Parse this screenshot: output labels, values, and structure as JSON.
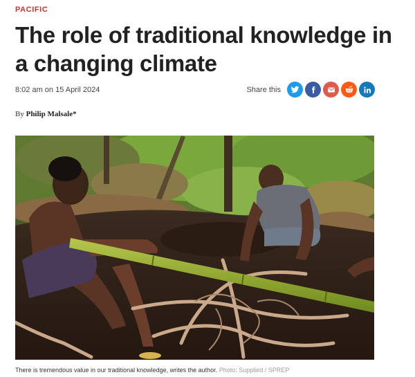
{
  "article": {
    "kicker": "PACIFIC",
    "headline": "The role of traditional knowledge in a changing climate",
    "timestamp": "8:02 am on 15 April 2024",
    "byline_prefix": "By",
    "author": "Philip Malsale*",
    "caption": "There is tremendous value in our traditional knowledge, writes the author.",
    "photo_credit": "Photo: Supplied / SPREP"
  },
  "share": {
    "label": "Share this",
    "buttons": [
      {
        "icon": "twitter-icon",
        "color": "#1d9bf0"
      },
      {
        "icon": "facebook-icon",
        "color": "#3b5ba5"
      },
      {
        "icon": "email-icon",
        "color": "#e2594c"
      },
      {
        "icon": "reddit-icon",
        "color": "#ff5a14"
      },
      {
        "icon": "linkedin-icon",
        "color": "#1479bb"
      }
    ]
  },
  "colors": {
    "kicker": "#d0302d",
    "text": "#222222"
  }
}
